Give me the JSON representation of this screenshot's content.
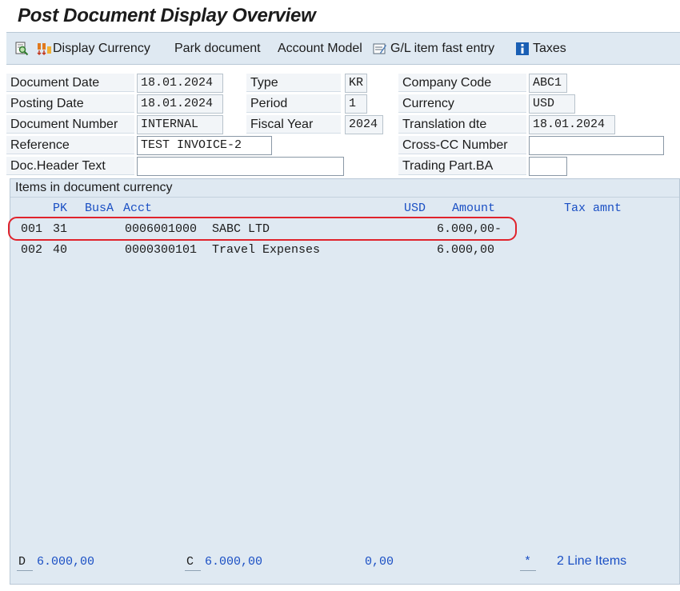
{
  "window": {
    "title": "Post Document Display Overview"
  },
  "toolbar": {
    "display_currency": "Display Currency",
    "park_document": "Park document",
    "account_model": "Account Model",
    "gl_fast_entry": "G/L item fast entry",
    "taxes": "Taxes"
  },
  "header": {
    "document_date": {
      "label": "Document Date",
      "value": "18.01.2024"
    },
    "posting_date": {
      "label": "Posting Date",
      "value": "18.01.2024"
    },
    "document_number": {
      "label": "Document Number",
      "value": "INTERNAL"
    },
    "reference": {
      "label": "Reference",
      "value": "TEST INVOICE-2"
    },
    "doc_header_text": {
      "label": "Doc.Header Text",
      "value": ""
    },
    "type": {
      "label": "Type",
      "value": "KR"
    },
    "period": {
      "label": "Period",
      "value": "1"
    },
    "fiscal_year": {
      "label": "Fiscal Year",
      "value": "2024"
    },
    "company_code": {
      "label": "Company Code",
      "value": "ABC1"
    },
    "currency": {
      "label": "Currency",
      "value": "USD"
    },
    "translation_date": {
      "label": "Translation dte",
      "value": "18.01.2024"
    },
    "cross_cc_number": {
      "label": "Cross-CC Number",
      "value": ""
    },
    "trading_part_ba": {
      "label": "Trading Part.BA",
      "value": ""
    }
  },
  "items": {
    "title": "Items in document currency",
    "columns": {
      "pk": "PK",
      "busa": "BusA",
      "acct": "Acct",
      "currency": "USD",
      "amount": "Amount",
      "tax_amount": "Tax amnt"
    },
    "rows": [
      {
        "item": "001",
        "pk": "31",
        "acct": "0006001000",
        "name": "SABC LTD",
        "amount": "6.000,00-"
      },
      {
        "item": "002",
        "pk": "40",
        "acct": "0000300101",
        "name": "Travel Expenses",
        "amount": "6.000,00"
      }
    ]
  },
  "totals": {
    "debit_label": "D",
    "debit_value": "6.000,00",
    "credit_label": "C",
    "credit_value": "6.000,00",
    "balance": "0,00",
    "star": "*",
    "line_items": "2 Line Items"
  }
}
